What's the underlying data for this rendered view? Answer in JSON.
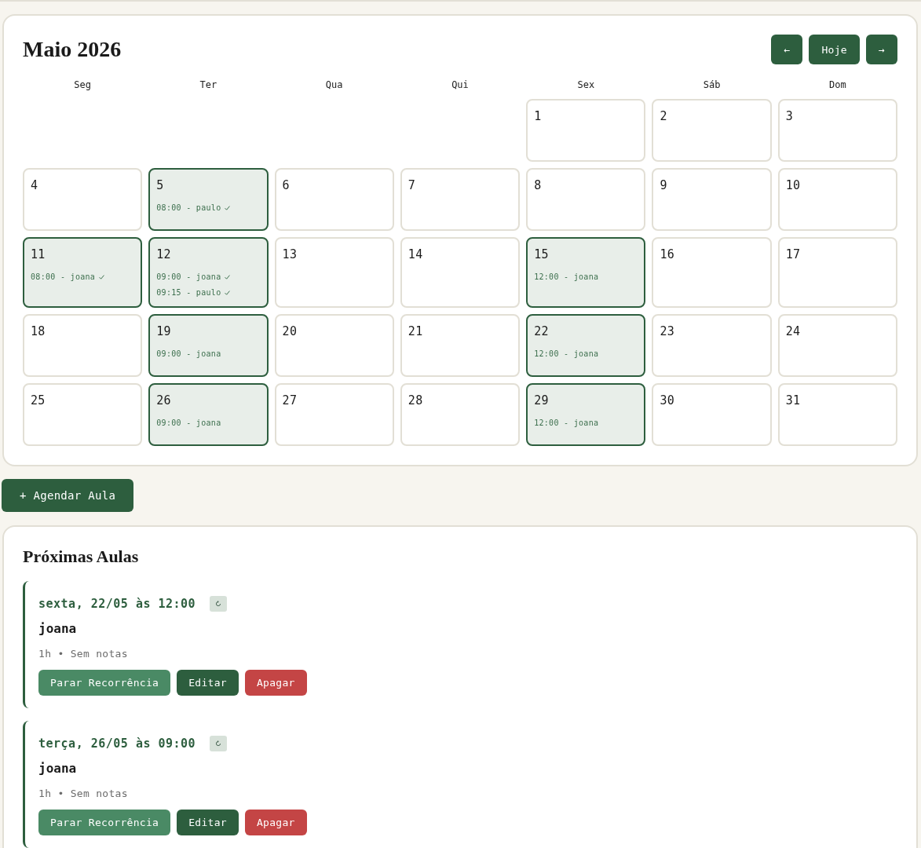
{
  "calendar": {
    "title": "Maio 2026",
    "nav": {
      "prev": "←",
      "today": "Hoje",
      "next": "→"
    },
    "weekdays": [
      "Seg",
      "Ter",
      "Qua",
      "Qui",
      "Sex",
      "Sáb",
      "Dom"
    ],
    "weeks": [
      {
        "days": [
          {
            "kind": "blank"
          },
          {
            "kind": "blank"
          },
          {
            "kind": "blank"
          },
          {
            "kind": "blank"
          },
          {
            "kind": "day",
            "number": "1"
          },
          {
            "kind": "day",
            "number": "2"
          },
          {
            "kind": "day",
            "number": "3"
          }
        ]
      },
      {
        "days": [
          {
            "kind": "day",
            "number": "4"
          },
          {
            "kind": "day",
            "number": "5",
            "events": [
              {
                "text": "08:00 - paulo",
                "done": true
              }
            ]
          },
          {
            "kind": "day",
            "number": "6"
          },
          {
            "kind": "day",
            "number": "7"
          },
          {
            "kind": "day",
            "number": "8"
          },
          {
            "kind": "day",
            "number": "9"
          },
          {
            "kind": "day",
            "number": "10"
          }
        ]
      },
      {
        "days": [
          {
            "kind": "day",
            "number": "11",
            "events": [
              {
                "text": "08:00 - joana",
                "done": true
              }
            ]
          },
          {
            "kind": "day",
            "number": "12",
            "events": [
              {
                "text": "09:00 - joana",
                "done": true
              },
              {
                "text": "09:15 - paulo",
                "done": true
              }
            ]
          },
          {
            "kind": "day",
            "number": "13"
          },
          {
            "kind": "day",
            "number": "14"
          },
          {
            "kind": "day",
            "number": "15",
            "events": [
              {
                "text": "12:00 - joana"
              }
            ]
          },
          {
            "kind": "day",
            "number": "16"
          },
          {
            "kind": "day",
            "number": "17"
          }
        ]
      },
      {
        "days": [
          {
            "kind": "day",
            "number": "18"
          },
          {
            "kind": "day",
            "number": "19",
            "events": [
              {
                "text": "09:00 - joana"
              }
            ]
          },
          {
            "kind": "day",
            "number": "20"
          },
          {
            "kind": "day",
            "number": "21"
          },
          {
            "kind": "day",
            "number": "22",
            "events": [
              {
                "text": "12:00 - joana"
              }
            ]
          },
          {
            "kind": "day",
            "number": "23"
          },
          {
            "kind": "day",
            "number": "24"
          }
        ]
      },
      {
        "days": [
          {
            "kind": "day",
            "number": "25"
          },
          {
            "kind": "day",
            "number": "26",
            "events": [
              {
                "text": "09:00 - joana"
              }
            ]
          },
          {
            "kind": "day",
            "number": "27"
          },
          {
            "kind": "day",
            "number": "28"
          },
          {
            "kind": "day",
            "number": "29",
            "events": [
              {
                "text": "12:00 - joana"
              }
            ]
          },
          {
            "kind": "day",
            "number": "30"
          },
          {
            "kind": "day",
            "number": "31"
          }
        ]
      }
    ]
  },
  "schedule_button": "+ Agendar Aula",
  "upcoming": {
    "title": "Próximas Aulas",
    "lessons": [
      {
        "date": "sexta, 22/05 às 12:00",
        "recurring": true,
        "student": "joana",
        "meta": "1h • Sem notas",
        "actions": [
          {
            "kind": "stop",
            "label": "Parar Recorrência"
          },
          {
            "kind": "edit",
            "label": "Editar"
          },
          {
            "kind": "delete",
            "label": "Apagar"
          }
        ]
      },
      {
        "date": "terça, 26/05 às 09:00",
        "recurring": true,
        "student": "joana",
        "meta": "1h • Sem notas",
        "actions": [
          {
            "kind": "stop",
            "label": "Parar Recorrência"
          },
          {
            "kind": "edit",
            "label": "Editar"
          },
          {
            "kind": "delete",
            "label": "Apagar"
          }
        ]
      }
    ]
  }
}
